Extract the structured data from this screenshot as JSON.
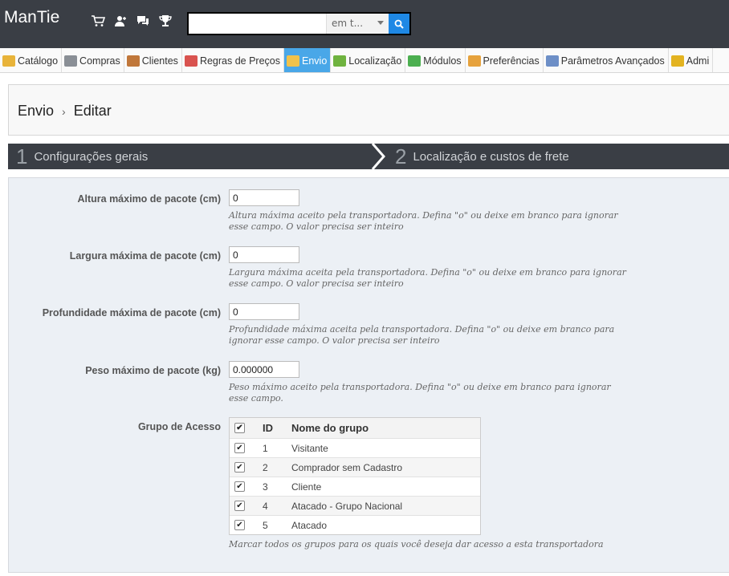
{
  "header": {
    "logo": "ManTie",
    "search": {
      "value": "",
      "placeholder": "",
      "scope": "em t..."
    }
  },
  "nav": [
    {
      "label": "Catálogo",
      "icon": "folder-icon",
      "color": "#e8b339"
    },
    {
      "label": "Compras",
      "icon": "cart-icon",
      "color": "#8a8f96"
    },
    {
      "label": "Clientes",
      "icon": "user-icon",
      "color": "#c0773a"
    },
    {
      "label": "Regras de Preços",
      "icon": "price-rules-icon",
      "color": "#d9534f"
    },
    {
      "label": "Envio",
      "icon": "truck-icon",
      "color": "#f0c24b",
      "active": true
    },
    {
      "label": "Localização",
      "icon": "globe-icon",
      "color": "#6fb33f"
    },
    {
      "label": "Módulos",
      "icon": "puzzle-icon",
      "color": "#4caf50"
    },
    {
      "label": "Preferências",
      "icon": "preferences-icon",
      "color": "#e6a23c"
    },
    {
      "label": "Parâmetros Avançados",
      "icon": "wrench-icon",
      "color": "#6d8fc7"
    },
    {
      "label": "Admi",
      "icon": "key-icon",
      "color": "#e3b320"
    }
  ],
  "breadcrumb": {
    "parent": "Envio",
    "separator": "›",
    "current": "Editar"
  },
  "steps": [
    {
      "num": "1",
      "label": "Configurações gerais"
    },
    {
      "num": "2",
      "label": "Localização e custos de frete"
    }
  ],
  "form": {
    "height": {
      "label": "Altura máximo de pacote (cm)",
      "value": "0",
      "hint": "Altura máxima aceito pela transportadora. Defina \"o\" ou deixe em branco para ignorar esse campo. O valor precisa ser inteiro"
    },
    "width": {
      "label": "Largura máxima de pacote (cm)",
      "value": "0",
      "hint": "Largura máxima aceita pela transportadora. Defina \"o\" ou deixe em branco para ignorar esse campo. O valor precisa ser inteiro"
    },
    "depth": {
      "label": "Profundidade máxima de pacote (cm)",
      "value": "0",
      "hint": "Profundidade máxima aceita pela transportadora. Defina \"o\" ou deixe em branco para ignorar esse campo. O valor precisa ser inteiro"
    },
    "weight": {
      "label": "Peso máximo de pacote (kg)",
      "value": "0.000000",
      "hint": "Peso máximo aceito pela transportadora. Defina \"o\" ou deixe em branco para ignorar esse campo."
    },
    "groups": {
      "label": "Grupo de Acesso",
      "col_id": "ID",
      "col_name": "Nome do grupo",
      "rows": [
        {
          "id": "1",
          "name": "Visitante",
          "checked": true
        },
        {
          "id": "2",
          "name": "Comprador sem Cadastro",
          "checked": true
        },
        {
          "id": "3",
          "name": "Cliente",
          "checked": true
        },
        {
          "id": "4",
          "name": "Atacado - Grupo Nacional",
          "checked": true
        },
        {
          "id": "5",
          "name": "Atacado",
          "checked": true
        }
      ],
      "hint": "Marcar todos os grupos para os quais você deseja dar acesso a esta transportadora"
    }
  }
}
